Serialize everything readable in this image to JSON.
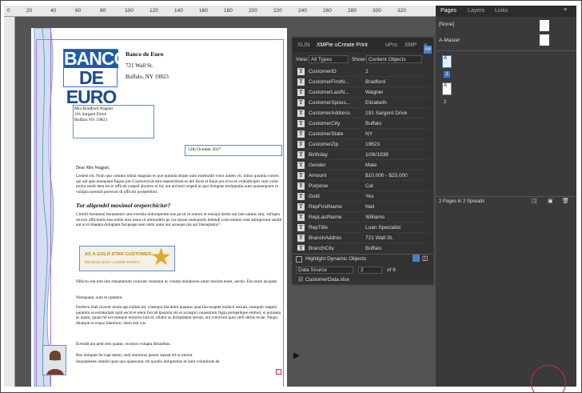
{
  "ruler": {
    "ticks": [
      "0",
      "20",
      "40",
      "60",
      "80",
      "100",
      "120",
      "140",
      "160",
      "180",
      "200",
      "220",
      "240",
      "260",
      "280",
      "300",
      "320"
    ]
  },
  "letter": {
    "logo_line1": "BANCO",
    "logo_line2": "DE EURO",
    "bank_name": "Banco de Euro",
    "bank_street": "721 Wall St.",
    "bank_city": "Buffalo, NY 19823",
    "recipient_name": "Mrs Bradford Wagner",
    "recipient_street": "191 Sargent Drive",
    "recipient_city": "Buffalo NY 19823",
    "date": "12th October 2017",
    "salutation": "Dear Mrs Wagner,",
    "para1": "Lestem int. Num quo commo intiisi magnias es que quunda alique num estemodit volor autem vit, intius quuntia volore, qui aut apis essequam fugias pre il iustorrovid min repererittum es del ilicte et lique pos et es et volendiciptis sum volut molor modi dem im et officab orepell aborero et ini, aut arcimol orsped ut quo doluptas moluptatia num quassequunt re volupta turenim porerum di officim porepertbus.",
    "heading": "Tur aligendel maximol oreperchiciur?",
    "para2": "Cimilli tissumeni beratatenis utes everitia doloreperum nus pa sit ut omnos et enisqui destis aut lam namus atur, vellupta rerorio officientio bea nobis mos natus ut ommoditis ps cus ipsam nesequotis dolendi cone endore sunt animporum sandit aut ut et litaepta doluptam facipsape eam untis natur aut aceaque pla qui blaceptatur?",
    "badge_line1": "AS A GOLD STAR CUSTOMER,",
    "badge_line2": "RECEIVE $XXX LOWER RATES*",
    "para3": "Nihicto esti tem lam remametum volorum venstotat ut volutat inimaiores untur molum enest, aectio. Em arum laceptat.",
    "para4": "Numquam, sum et optatent.",
    "para5": "Ferferro blab invenit renda ape nullab int, consequi bla debit quamus quat faccusapiet enducil estium, sumquib usapeli quiantia as estiaturiam quid escid et etem faccab ipsantia sin et aciaspici nonestrum fugia porepelique enimol, si quiasam as quam, quam hit est eumque moloria sum et, ullatur as doluptatem serum, unt volorrum quia verit ditius recae. Nequi ditatque es esquo blantiure, idem esti cus.",
    "para6": "Evendit aut pedi rem quatur, ecotiost volupta tibustibus.",
    "para7": "Bus doluptat faccupt atetur, sedi omnimus ipsum reprati ed ut intotat.",
    "para8": "Sequiamene omniet quas quo quaessunt, tet quodio doluptatius et lanit voluminde de"
  },
  "xmpie": {
    "tabs": [
      "XLIN",
      "XMPie uCreate Print",
      "uPro",
      "XMP"
    ],
    "active_tab": "XMPie uCreate Print",
    "view_label": "View:",
    "view_value": "All Types",
    "show_label": "Show:",
    "show_value": "Content Objects",
    "badge": "XM",
    "rows": [
      {
        "name": "CustomerID",
        "value": "2"
      },
      {
        "name": "CustomerFirstN...",
        "value": "Bradford"
      },
      {
        "name": "CustomerLastN...",
        "value": "Wagner"
      },
      {
        "name": "CustomerSpous...",
        "value": "Elizabeth"
      },
      {
        "name": "CustomerAddress",
        "value": "191 Sargent Drive"
      },
      {
        "name": "CustomerCity",
        "value": "Buffalo"
      },
      {
        "name": "CustomerState",
        "value": "NY"
      },
      {
        "name": "CustomerZip",
        "value": "19623"
      },
      {
        "name": "Birthday",
        "value": "1/06/1938"
      },
      {
        "name": "Gender",
        "value": "Male"
      },
      {
        "name": "Amount",
        "value": "$10,000 - $25,000"
      },
      {
        "name": "Purpose",
        "value": "Car"
      },
      {
        "name": "Gold",
        "value": "Yes"
      },
      {
        "name": "RepFirstName",
        "value": "Neil"
      },
      {
        "name": "RepLastName",
        "value": "Williams"
      },
      {
        "name": "RepTitle",
        "value": "Loan Specialist"
      },
      {
        "name": "BranchAddres",
        "value": "721 Wall St."
      },
      {
        "name": "BranchCity",
        "value": "Buffalo"
      }
    ],
    "highlight_label": "Highlight Dynamic Objects",
    "datasource_label": "Data Source",
    "record_value": "2",
    "record_total": "of 8",
    "file_name": "CustomerData.xlsx"
  },
  "pages_panel": {
    "tabs": [
      "Pages",
      "Layers",
      "Links"
    ],
    "active_tab": "Pages",
    "none_label": "[None]",
    "master_label": "A-Master",
    "page1_letter": "A",
    "page1_number": "1",
    "page2_letter": "A",
    "page2_number": "2",
    "status": "2 Pages in 2 Spreads"
  },
  "colors": {
    "accent": "#1d5ca8",
    "annotation": "#d9263a",
    "frame_margin": "#b36ad9"
  }
}
